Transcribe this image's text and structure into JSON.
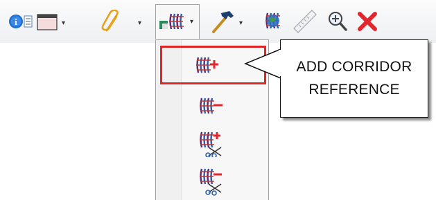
{
  "toolbar": {
    "items": [
      {
        "icon": "info-list-icon"
      },
      {
        "icon": "window-icon",
        "dropdown": true
      },
      {
        "icon": "paperclip-icon",
        "dropdown": true
      },
      {
        "icon": "corridor-reference-icon",
        "dropdown": true,
        "active": true
      },
      {
        "icon": "hammer-icon",
        "dropdown": true
      },
      {
        "icon": "corridor-globe-icon"
      },
      {
        "icon": "ruler-icon"
      },
      {
        "icon": "zoom-in-icon"
      },
      {
        "icon": "close-icon"
      }
    ]
  },
  "menu": {
    "items": [
      {
        "icon": "add-corridor-reference-icon",
        "selected": true
      },
      {
        "icon": "remove-corridor-reference-icon"
      },
      {
        "icon": "add-clip-corridor-reference-icon"
      },
      {
        "icon": "remove-clip-corridor-reference-icon"
      }
    ]
  },
  "callout": {
    "text": "ADD CORRIDOR\nREFERENCE"
  },
  "colors": {
    "highlight_border": "#e12525",
    "close_red": "#e3262e",
    "corridor_purple": "#5a2a78",
    "corridor_blue": "#2a5fb0"
  }
}
